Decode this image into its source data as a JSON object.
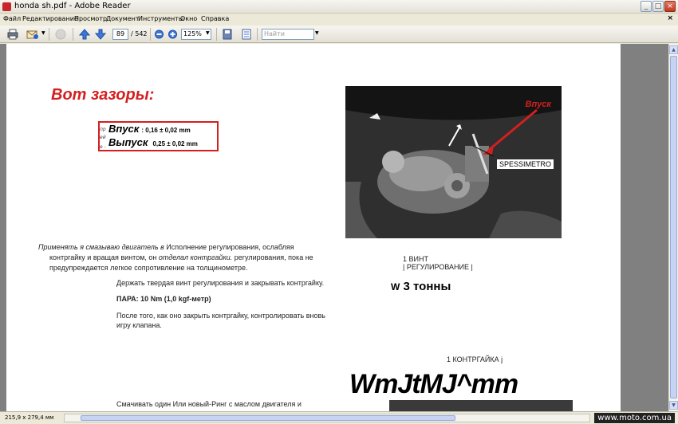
{
  "window": {
    "title": "honda sh.pdf - Adobe Reader",
    "minimize": "_",
    "maximize": "□",
    "close": "×",
    "menu_close": "×"
  },
  "menu": {
    "items": [
      "Файл",
      "Редактирование",
      "Просмотр",
      "Документ",
      "Инструменты",
      "Окно",
      "Справка"
    ]
  },
  "toolbar": {
    "page_current": "89",
    "page_total": "/ 542",
    "zoom": "125%",
    "search_placeholder": "Найти"
  },
  "icons": {
    "print": "print-icon",
    "email": "email-icon",
    "disabled": "hand-icon",
    "prev": "up-arrow-icon",
    "next": "down-arrow-icon",
    "zoom_out": "zoom-out-icon",
    "zoom_in": "zoom-in-icon",
    "save": "save-icon",
    "fit": "fit-page-icon"
  },
  "document": {
    "heading": "Вот зазоры:",
    "spec1_label": "Впуск",
    "spec1_value": ": 0,16 ± 0,02 mm",
    "spec2_label": "Выпуск",
    "spec2_value": "0,25 ± 0,02 mm",
    "junk1": "пр",
    "junk2": "ей",
    "junk3": "е -",
    "photo_label_intake": "Впуск",
    "photo_label_gauge": "SPESSIMETRO",
    "para1_line1_italic": "Применять я смазываю двигатель в",
    "para1_line1_rest": " Исполнение регулирования, ослабляя",
    "para1_line2_a": "контргайку и вращая винтом, он ",
    "para1_line2_italic": "отделал контргайки.",
    "para1_line2_b": " регулирования, пока не",
    "para1_line3": "предупреждается легкое сопротивление на толщинометре.",
    "para2": "Держать твердая винт регулирования и закрывать контргайку.",
    "torque": "ПАРА: 10 Nm (1,0 kgf-метр)",
    "para3_line1": "После того, как оно закрыть контргайку, контролировать вновь",
    "para3_line2": "игру клапана.",
    "right_label1": "1 ВИНТ",
    "right_label2": "| РЕГУЛИРОВАНИЕ |",
    "big_w": "W",
    "big_tonny": "3 тонны",
    "contra_label": "1 КОНТРГАЙКА j",
    "garble": "WmJtMJ^mm",
    "bottom_text": "Смачивать один Или новый-Ринг с маслом двигателя и"
  },
  "status": {
    "page_size": "215,9 x 279,4 мм",
    "watermark": "www.moto.com.ua"
  }
}
